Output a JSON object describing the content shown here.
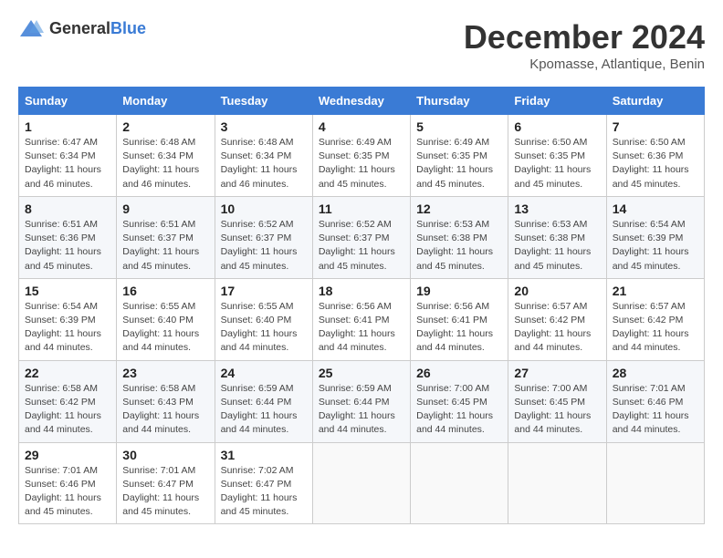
{
  "header": {
    "logo_general": "General",
    "logo_blue": "Blue",
    "month_title": "December 2024",
    "location": "Kpomasse, Atlantique, Benin"
  },
  "calendar": {
    "days_of_week": [
      "Sunday",
      "Monday",
      "Tuesday",
      "Wednesday",
      "Thursday",
      "Friday",
      "Saturday"
    ],
    "weeks": [
      [
        {
          "day": "",
          "empty": true
        },
        {
          "day": "",
          "empty": true
        },
        {
          "day": "",
          "empty": true
        },
        {
          "day": "",
          "empty": true
        },
        {
          "day": "",
          "empty": true
        },
        {
          "day": "",
          "empty": true
        },
        {
          "day": "",
          "empty": true
        }
      ],
      [
        {
          "day": "1",
          "sunrise": "Sunrise: 6:47 AM",
          "sunset": "Sunset: 6:34 PM",
          "daylight": "Daylight: 11 hours and 46 minutes."
        },
        {
          "day": "2",
          "sunrise": "Sunrise: 6:48 AM",
          "sunset": "Sunset: 6:34 PM",
          "daylight": "Daylight: 11 hours and 46 minutes."
        },
        {
          "day": "3",
          "sunrise": "Sunrise: 6:48 AM",
          "sunset": "Sunset: 6:34 PM",
          "daylight": "Daylight: 11 hours and 46 minutes."
        },
        {
          "day": "4",
          "sunrise": "Sunrise: 6:49 AM",
          "sunset": "Sunset: 6:35 PM",
          "daylight": "Daylight: 11 hours and 45 minutes."
        },
        {
          "day": "5",
          "sunrise": "Sunrise: 6:49 AM",
          "sunset": "Sunset: 6:35 PM",
          "daylight": "Daylight: 11 hours and 45 minutes."
        },
        {
          "day": "6",
          "sunrise": "Sunrise: 6:50 AM",
          "sunset": "Sunset: 6:35 PM",
          "daylight": "Daylight: 11 hours and 45 minutes."
        },
        {
          "day": "7",
          "sunrise": "Sunrise: 6:50 AM",
          "sunset": "Sunset: 6:36 PM",
          "daylight": "Daylight: 11 hours and 45 minutes."
        }
      ],
      [
        {
          "day": "8",
          "sunrise": "Sunrise: 6:51 AM",
          "sunset": "Sunset: 6:36 PM",
          "daylight": "Daylight: 11 hours and 45 minutes."
        },
        {
          "day": "9",
          "sunrise": "Sunrise: 6:51 AM",
          "sunset": "Sunset: 6:37 PM",
          "daylight": "Daylight: 11 hours and 45 minutes."
        },
        {
          "day": "10",
          "sunrise": "Sunrise: 6:52 AM",
          "sunset": "Sunset: 6:37 PM",
          "daylight": "Daylight: 11 hours and 45 minutes."
        },
        {
          "day": "11",
          "sunrise": "Sunrise: 6:52 AM",
          "sunset": "Sunset: 6:37 PM",
          "daylight": "Daylight: 11 hours and 45 minutes."
        },
        {
          "day": "12",
          "sunrise": "Sunrise: 6:53 AM",
          "sunset": "Sunset: 6:38 PM",
          "daylight": "Daylight: 11 hours and 45 minutes."
        },
        {
          "day": "13",
          "sunrise": "Sunrise: 6:53 AM",
          "sunset": "Sunset: 6:38 PM",
          "daylight": "Daylight: 11 hours and 45 minutes."
        },
        {
          "day": "14",
          "sunrise": "Sunrise: 6:54 AM",
          "sunset": "Sunset: 6:39 PM",
          "daylight": "Daylight: 11 hours and 45 minutes."
        }
      ],
      [
        {
          "day": "15",
          "sunrise": "Sunrise: 6:54 AM",
          "sunset": "Sunset: 6:39 PM",
          "daylight": "Daylight: 11 hours and 44 minutes."
        },
        {
          "day": "16",
          "sunrise": "Sunrise: 6:55 AM",
          "sunset": "Sunset: 6:40 PM",
          "daylight": "Daylight: 11 hours and 44 minutes."
        },
        {
          "day": "17",
          "sunrise": "Sunrise: 6:55 AM",
          "sunset": "Sunset: 6:40 PM",
          "daylight": "Daylight: 11 hours and 44 minutes."
        },
        {
          "day": "18",
          "sunrise": "Sunrise: 6:56 AM",
          "sunset": "Sunset: 6:41 PM",
          "daylight": "Daylight: 11 hours and 44 minutes."
        },
        {
          "day": "19",
          "sunrise": "Sunrise: 6:56 AM",
          "sunset": "Sunset: 6:41 PM",
          "daylight": "Daylight: 11 hours and 44 minutes."
        },
        {
          "day": "20",
          "sunrise": "Sunrise: 6:57 AM",
          "sunset": "Sunset: 6:42 PM",
          "daylight": "Daylight: 11 hours and 44 minutes."
        },
        {
          "day": "21",
          "sunrise": "Sunrise: 6:57 AM",
          "sunset": "Sunset: 6:42 PM",
          "daylight": "Daylight: 11 hours and 44 minutes."
        }
      ],
      [
        {
          "day": "22",
          "sunrise": "Sunrise: 6:58 AM",
          "sunset": "Sunset: 6:42 PM",
          "daylight": "Daylight: 11 hours and 44 minutes."
        },
        {
          "day": "23",
          "sunrise": "Sunrise: 6:58 AM",
          "sunset": "Sunset: 6:43 PM",
          "daylight": "Daylight: 11 hours and 44 minutes."
        },
        {
          "day": "24",
          "sunrise": "Sunrise: 6:59 AM",
          "sunset": "Sunset: 6:44 PM",
          "daylight": "Daylight: 11 hours and 44 minutes."
        },
        {
          "day": "25",
          "sunrise": "Sunrise: 6:59 AM",
          "sunset": "Sunset: 6:44 PM",
          "daylight": "Daylight: 11 hours and 44 minutes."
        },
        {
          "day": "26",
          "sunrise": "Sunrise: 7:00 AM",
          "sunset": "Sunset: 6:45 PM",
          "daylight": "Daylight: 11 hours and 44 minutes."
        },
        {
          "day": "27",
          "sunrise": "Sunrise: 7:00 AM",
          "sunset": "Sunset: 6:45 PM",
          "daylight": "Daylight: 11 hours and 44 minutes."
        },
        {
          "day": "28",
          "sunrise": "Sunrise: 7:01 AM",
          "sunset": "Sunset: 6:46 PM",
          "daylight": "Daylight: 11 hours and 44 minutes."
        }
      ],
      [
        {
          "day": "29",
          "sunrise": "Sunrise: 7:01 AM",
          "sunset": "Sunset: 6:46 PM",
          "daylight": "Daylight: 11 hours and 45 minutes."
        },
        {
          "day": "30",
          "sunrise": "Sunrise: 7:01 AM",
          "sunset": "Sunset: 6:47 PM",
          "daylight": "Daylight: 11 hours and 45 minutes."
        },
        {
          "day": "31",
          "sunrise": "Sunrise: 7:02 AM",
          "sunset": "Sunset: 6:47 PM",
          "daylight": "Daylight: 11 hours and 45 minutes."
        },
        {
          "day": "",
          "empty": true
        },
        {
          "day": "",
          "empty": true
        },
        {
          "day": "",
          "empty": true
        },
        {
          "day": "",
          "empty": true
        }
      ]
    ]
  }
}
